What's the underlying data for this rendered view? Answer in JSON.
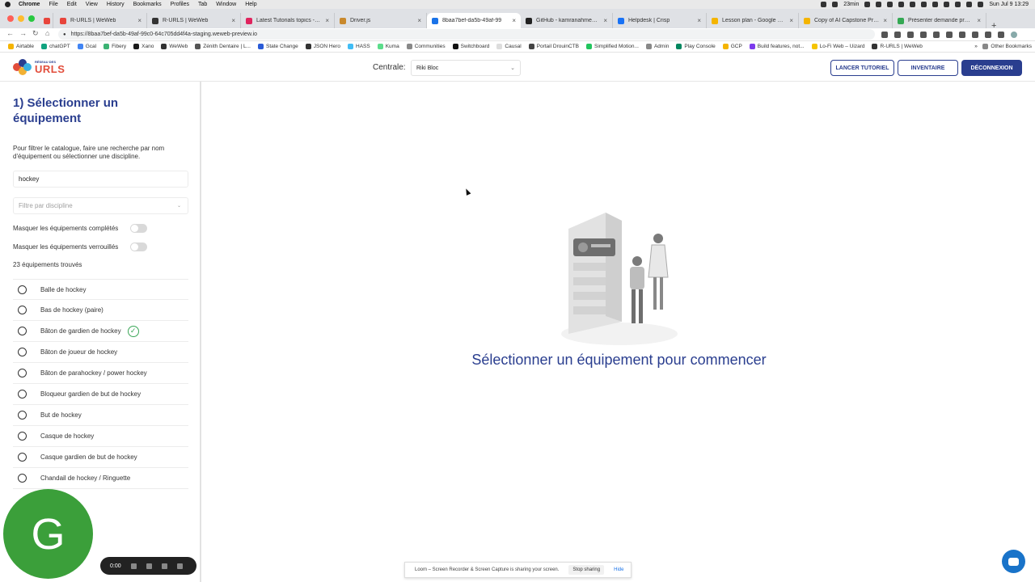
{
  "os_menubar": {
    "app": "Chrome",
    "items": [
      "File",
      "Edit",
      "View",
      "History",
      "Bookmarks",
      "Profiles",
      "Tab",
      "Window",
      "Help"
    ],
    "timer": "23min",
    "clock": "Sun Jul 9  13:29"
  },
  "browser": {
    "tabs": [
      {
        "label": "R-URLS | WeWeb",
        "color": "#e8453c"
      },
      {
        "label": "R-URLS | WeWeb",
        "color": "#333333"
      },
      {
        "label": "Latest Tutorials topics - WeW",
        "color": "#e0245e"
      },
      {
        "label": "Driver.js",
        "color": "#c9892c"
      },
      {
        "label": "8baa7bef-da5b-49af-99",
        "color": "#1a73e8"
      },
      {
        "label": "GitHub - kamranahmedse/dri",
        "color": "#222222"
      },
      {
        "label": "Helpdesk | Crisp",
        "color": "#1972f5"
      },
      {
        "label": "Lesson plan - Google Slides",
        "color": "#f4b400"
      },
      {
        "label": "Copy of AI Capstone Project",
        "color": "#f4b400"
      },
      {
        "label": "Présenter demande program",
        "color": "#34a853"
      }
    ],
    "url": "https://8baa7bef-da5b-49af-99c0-64c705dd4f4a-staging.weweb-preview.io",
    "bookmarks": [
      {
        "label": "Airtable",
        "color": "#f5b400"
      },
      {
        "label": "chatGPT",
        "color": "#10a37f"
      },
      {
        "label": "Gcal",
        "color": "#4285f4"
      },
      {
        "label": "Fibery",
        "color": "#3bb273"
      },
      {
        "label": "Xano",
        "color": "#1a1a1a"
      },
      {
        "label": "WeWeb",
        "color": "#333333"
      },
      {
        "label": "Zénith Dentaire | L...",
        "color": "#555555"
      },
      {
        "label": "State Change",
        "color": "#2a5bd7"
      },
      {
        "label": "JSON Hero",
        "color": "#333333"
      },
      {
        "label": "HASS",
        "color": "#41bdf5"
      },
      {
        "label": "Kuma",
        "color": "#5cdd8b"
      },
      {
        "label": "Communities",
        "color": "#888888"
      },
      {
        "label": "Switchboard",
        "color": "#111111"
      },
      {
        "label": "Causal",
        "color": "#dddddd"
      },
      {
        "label": "Portail DrouinCTB",
        "color": "#444444"
      },
      {
        "label": "Simplified Motion...",
        "color": "#22c55e"
      },
      {
        "label": "Admin",
        "color": "#888888"
      },
      {
        "label": "Play Console",
        "color": "#01875f"
      },
      {
        "label": "GCP",
        "color": "#f4b400"
      },
      {
        "label": "Build features, not...",
        "color": "#7c3aed"
      },
      {
        "label": "Lo-Fi Web – Uizard",
        "color": "#f5c400"
      },
      {
        "label": "R-URLS | WeWeb",
        "color": "#333333"
      }
    ],
    "other_bookmarks": "Other Bookmarks"
  },
  "header": {
    "logo_small": "RÉSEAU DES",
    "logo_big": "URLS",
    "centrale_label": "Centrale:",
    "centrale_value": "Riki Bloc",
    "buttons": {
      "tutorial": "LANCER TUTORIEL",
      "inventory": "INVENTAIRE",
      "logout": "DÉCONNEXION"
    }
  },
  "sidebar": {
    "title": "1) Sélectionner un équipement",
    "description": "Pour filtrer le catalogue, faire une recherche par nom d'équipement ou sélectionner une discipline.",
    "search_value": "hockey",
    "discipline_placeholder": "Filtre par discipline",
    "toggles": {
      "hide_completed": "Masquer les équipements complétés",
      "hide_locked": "Masquer les équipements verrouillés"
    },
    "count_text": "23 équipements trouvés",
    "items": [
      {
        "label": "Balle de hockey",
        "completed": false
      },
      {
        "label": "Bas de hockey (paire)",
        "completed": false
      },
      {
        "label": "Bâton de gardien de hockey",
        "completed": true
      },
      {
        "label": "Bâton de joueur de hockey",
        "completed": false
      },
      {
        "label": "Bâton de parahockey / power hockey",
        "completed": false
      },
      {
        "label": "Bloqueur gardien de but de hockey",
        "completed": false
      },
      {
        "label": "But de hockey",
        "completed": false
      },
      {
        "label": "Casque de hockey",
        "completed": false
      },
      {
        "label": "Casque gardien de but de hockey",
        "completed": false
      },
      {
        "label": "Chandail de hockey / Ringuette",
        "completed": false
      }
    ]
  },
  "main": {
    "empty_message": "Sélectionner un équipement pour commencer"
  },
  "overlays": {
    "avatar_letter": "G",
    "avatar_color": "#3b9f3a",
    "recorder_time": "0:00",
    "loom_text": "Loom – Screen Recorder & Screen Capture is sharing your screen.",
    "loom_stop": "Stop sharing",
    "loom_hide": "Hide"
  },
  "colors": {
    "brand_blue": "#2a3e8f",
    "brand_red": "#e24d3b",
    "check_green": "#3aa657",
    "chat_blue": "#1973c9"
  }
}
